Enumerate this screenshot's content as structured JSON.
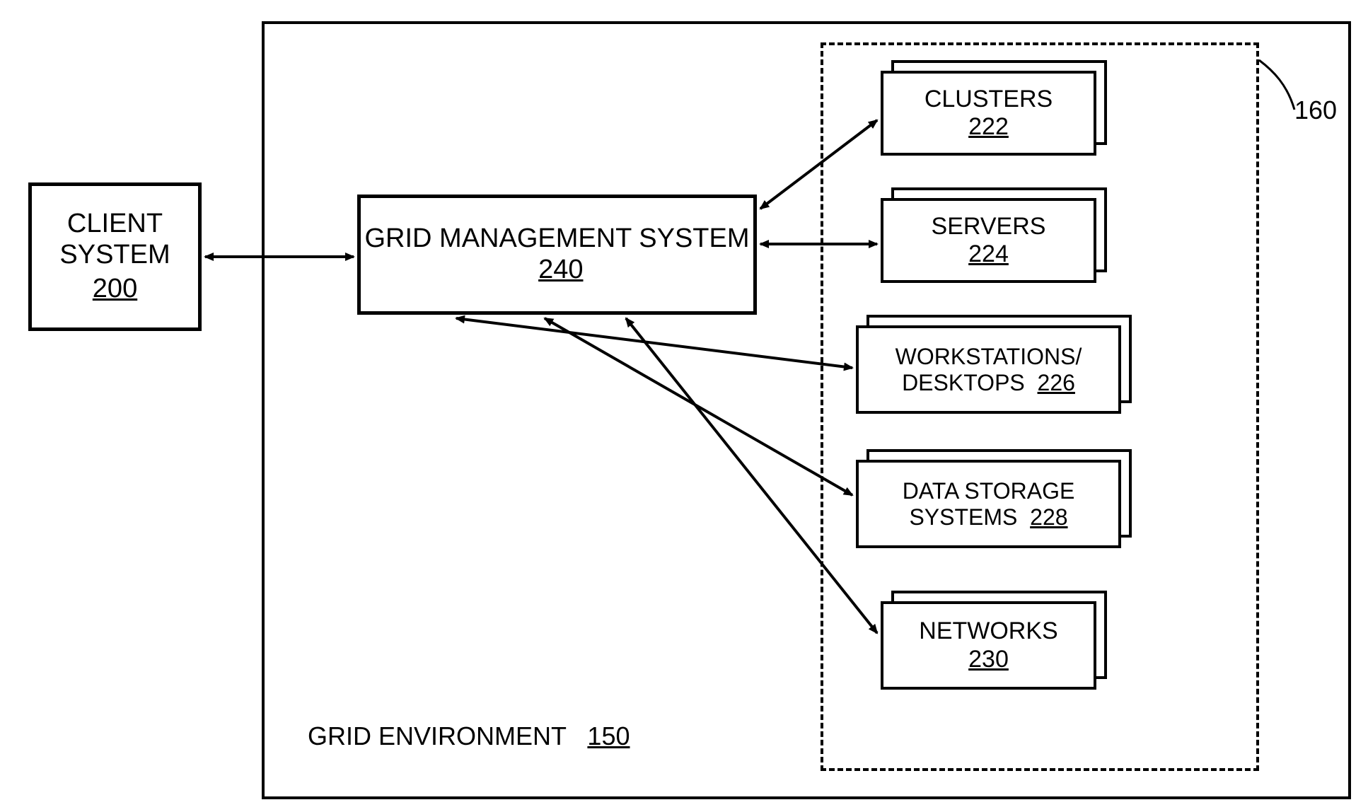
{
  "client_system": {
    "title": "CLIENT SYSTEM",
    "ref": "200"
  },
  "grid_env": {
    "title": "GRID ENVIRONMENT",
    "ref": "150"
  },
  "grid_mgmt": {
    "title": "GRID MANAGEMENT SYSTEM",
    "ref": "240"
  },
  "resource_group_ref": "160",
  "resources": {
    "clusters": {
      "title": "CLUSTERS",
      "ref": "222"
    },
    "servers": {
      "title": "SERVERS",
      "ref": "224"
    },
    "workstations": {
      "title": "WORKSTATIONS/ DESKTOPS",
      "ref": "226"
    },
    "data_storage": {
      "title": "DATA STORAGE SYSTEMS",
      "ref": "228"
    },
    "networks": {
      "title": "NETWORKS",
      "ref": "230"
    }
  }
}
